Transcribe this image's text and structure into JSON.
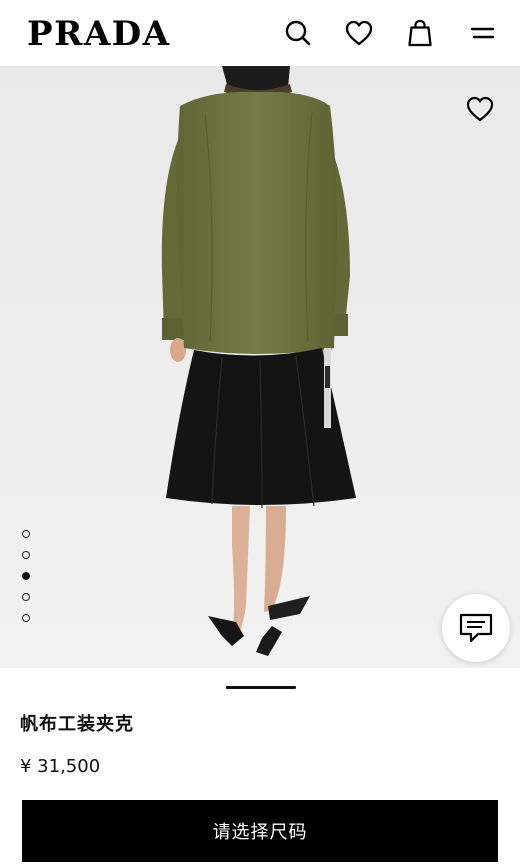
{
  "header": {
    "brand": "PRADA",
    "icons": [
      "search-icon",
      "heart-icon",
      "shopping-bag-icon",
      "menu-icon"
    ]
  },
  "gallery": {
    "image_count": 5,
    "active_index": 2,
    "favorite_icon": "heart-icon",
    "chat_icon": "chat-bubble-icon"
  },
  "product": {
    "title": "帆布工装夹克",
    "price": "¥ 31,500"
  },
  "cta": {
    "label": "请选择尺码"
  },
  "colors": {
    "cta_background": "#000000",
    "jacket": "#6e7340",
    "skirt": "#121212",
    "image_background": "#ececec"
  }
}
